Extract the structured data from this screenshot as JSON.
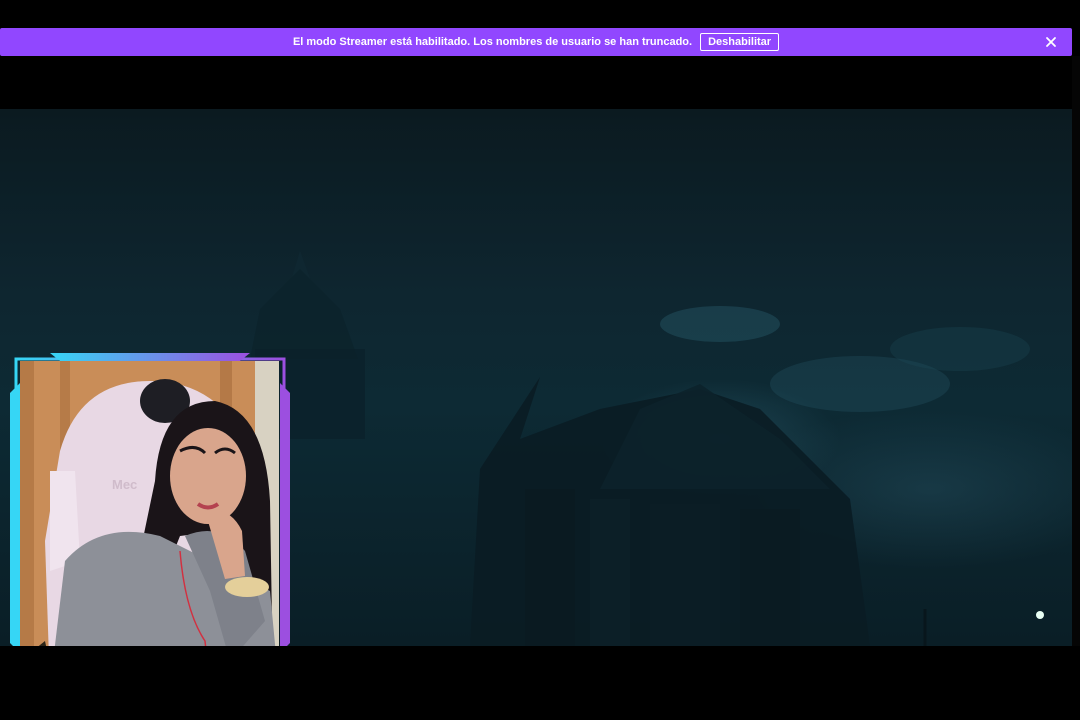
{
  "banner": {
    "message": "El modo Streamer está habilitado. Los nombres de usuario se han truncado.",
    "disable_label": "Deshabilitar",
    "close_icon": "close-icon",
    "color": "#9147ff"
  },
  "video": {
    "scene": "dark haunted house at night",
    "overlay": {
      "webcam_frame_colors": [
        "#36d6f5",
        "#9c4fe0"
      ],
      "chair_brand_text": "Mec"
    }
  }
}
